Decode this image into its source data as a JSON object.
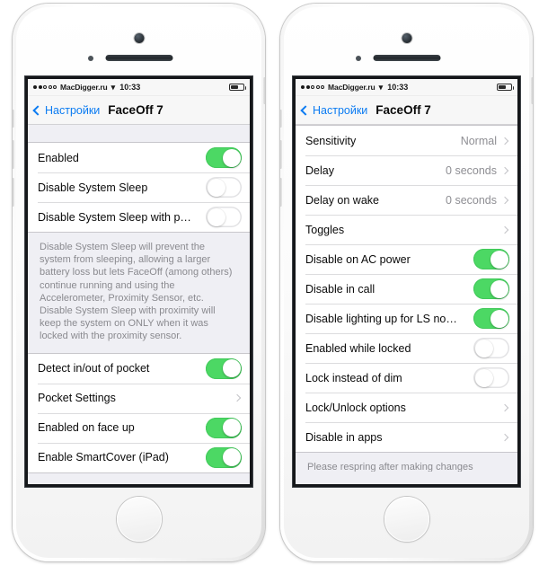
{
  "statusbar": {
    "carrier": "MacDigger.ru",
    "time": "10:33",
    "wifi_icon": "wifi-icon",
    "battery_icon": "battery-icon",
    "signal_icon": "signal-dots-icon"
  },
  "navbar": {
    "back_label": "Настройки",
    "title": "FaceOff 7",
    "back_icon": "chevron-left-icon"
  },
  "left_phone": {
    "section1": [
      {
        "label": "Enabled",
        "type": "switch",
        "value": "on"
      },
      {
        "label": "Disable System Sleep",
        "type": "switch",
        "value": "off"
      },
      {
        "label": "Disable System Sleep with p…",
        "type": "switch",
        "value": "off"
      }
    ],
    "footer": "Disable System Sleep will prevent the system from sleeping, allowing a larger battery loss but lets FaceOff (among others) continue running and using the Accelerometer, Proximity Sensor, etc. Disable System Sleep with proximity will keep the system on ONLY when it was locked with the proximity sensor.",
    "section2": [
      {
        "label": "Detect in/out of pocket",
        "type": "switch",
        "value": "on"
      },
      {
        "label": "Pocket Settings",
        "type": "disclosure",
        "value": ""
      },
      {
        "label": "Enabled on face up",
        "type": "switch",
        "value": "on"
      },
      {
        "label": "Enable SmartCover (iPad)",
        "type": "switch",
        "value": "on"
      }
    ]
  },
  "right_phone": {
    "section1": [
      {
        "label": "Sensitivity",
        "type": "disclosure",
        "value": "Normal"
      },
      {
        "label": "Delay",
        "type": "disclosure",
        "value": "0 seconds"
      },
      {
        "label": "Delay on wake",
        "type": "disclosure",
        "value": "0 seconds"
      },
      {
        "label": "Toggles",
        "type": "disclosure",
        "value": ""
      },
      {
        "label": "Disable on AC power",
        "type": "switch",
        "value": "on"
      },
      {
        "label": "Disable in call",
        "type": "switch",
        "value": "on"
      },
      {
        "label": "Disable lighting up for LS no…",
        "type": "switch",
        "value": "on"
      },
      {
        "label": "Enabled while locked",
        "type": "switch",
        "value": "off"
      },
      {
        "label": "Lock instead of dim",
        "type": "switch",
        "value": "off"
      },
      {
        "label": "Lock/Unlock options",
        "type": "disclosure",
        "value": ""
      },
      {
        "label": "Disable in apps",
        "type": "disclosure",
        "value": ""
      }
    ],
    "footer": "Please respring after making changes"
  },
  "colors": {
    "switch_on": "#4cd864",
    "tint_blue": "#0b7bf2",
    "group_bg": "#efeff4",
    "value_gray": "#8e8e93"
  }
}
